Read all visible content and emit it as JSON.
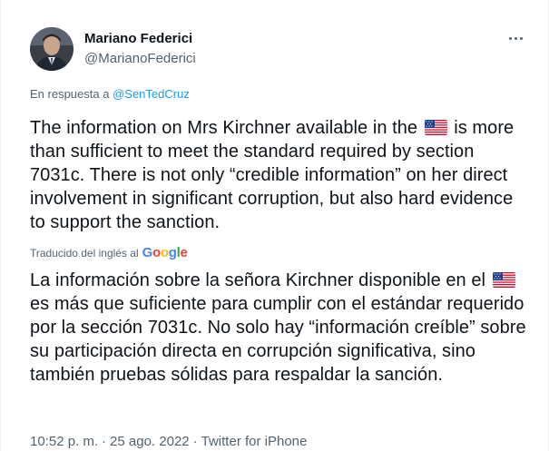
{
  "author": {
    "name": "Mariano Federici",
    "handle": "@MarianoFederici",
    "avatar_icon": "user-avatar"
  },
  "more_icon": "ellipsis-icon",
  "reply": {
    "prefix": "En respuesta a",
    "mention": "@SenTedCruz"
  },
  "original": {
    "part1": "The information on Mrs Kirchner available in the",
    "part2": "is more than sufficient to meet the standard required by section 7031c. There is not only “credible information” on her direct involvement in significant corruption, but also hard evidence to support the sanction."
  },
  "translation_note": {
    "label": "Traducido del inglés al",
    "brand_letters": [
      "G",
      "o",
      "o",
      "g",
      "l",
      "e"
    ]
  },
  "translated": {
    "part1": "La información sobre la señora Kirchner disponible en el",
    "part2": "es más que suficiente para cumplir con el estándar requerido por la sección 7031c. No solo hay “información creíble” sobre su participación directa en corrupción significativa, sino también pruebas sólidas para respaldar la sanción."
  },
  "meta": {
    "time": "10:52 p. m.",
    "date": "25 ago. 2022",
    "source": "Twitter for iPhone",
    "separator": "·"
  },
  "colors": {
    "link": "#1d9bf0",
    "secondary_text": "#536471",
    "primary_text": "#0f1419"
  }
}
